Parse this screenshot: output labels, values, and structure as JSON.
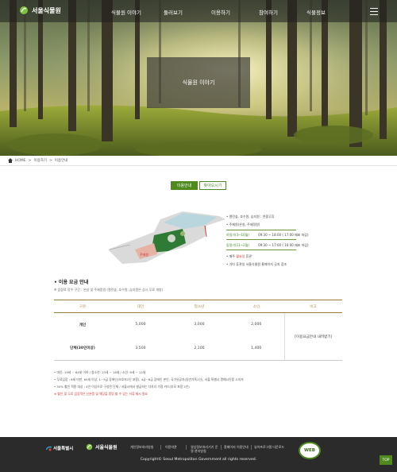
{
  "header": {
    "logo_text": "서울식물원",
    "nav": [
      "식물원 이야기",
      "둘러보기",
      "이용하기",
      "참여하기",
      "식물정보"
    ]
  },
  "hero": {
    "title": "식물원 이야기"
  },
  "breadcrumb": [
    "HOME",
    "이용하기",
    "이용안내"
  ],
  "tabs": [
    "이용안내",
    "찾아오시기"
  ],
  "map_legend": {
    "line1": "• 열린숲, 호수원, 습지원 : 연중무휴",
    "line2": "• 주제원(온실, 주제정원)",
    "hours1_label": "하절기(3~10월)",
    "hours1_value": "09:30 ~ 18:00 ( 17:00 매표 마감)",
    "hours2_label": "동절기(11~2월)",
    "hours2_value": "09:30 ~ 17:00 ( 16:00 매표 마감)",
    "closed_prefix": "• 매주",
    "closed_day": "월요일",
    "closed_suffix": "휴관",
    "holiday": "• 기타 휴관일 서울식물원 홈페이지 공지 참조",
    "zone_label": "주제원"
  },
  "fees": {
    "title": "• 이용 요금 안내",
    "subtitle": "※ 입장료 징수 구간 : 온실 및 주제정원 (열린숲, 호수원, 습지원은 상시 무료 개방)",
    "columns": [
      "구분",
      "대인",
      "청소년",
      "소인",
      "비고"
    ],
    "rows": [
      {
        "label": "개인",
        "adult": "5,000",
        "youth": "3,000",
        "child": "2,000"
      },
      {
        "label": "단체(30인이상)",
        "adult": "3,500",
        "youth": "2,100",
        "child": "1,400"
      }
    ],
    "note": "[이용요금안내 내려받기]"
  },
  "notes": [
    "• 대인: 19세 ~ 64세 이하 / 청소년: 13세 ~ 18세 / 소인: 6세 ~ 12세",
    "• 무료입장 : 6세 미만, 65세 이상, 1~3급 장애인(보호자1인 포함), 4급~6급 장애인 본인, 국가유공자(동반가족1인), 서울 특별시 명예시민증 소지자",
    "• 50% 할인 적용 대상 : 4인 이상으로 구성된 단체 / 서울시에서 발급하는 다자녀 가정 카드(부모 포함 2인)",
    "※ 할인 및 무료 입장객은 신분증 및 해당을 증빙 할 수 있는 서류 제시 필요"
  ],
  "footer": {
    "seoul_logo": "서울특별시",
    "arb_logo": "서울식물원",
    "links": [
      "개인정보처리방침",
      "이용약관",
      "영상정보처리기기 운영·관리방침",
      "홈페이지 이용안내",
      "뷰어프로그램 다운로드"
    ],
    "copyright": "Copyright© Seoul Metropolitan Government all rights reserved.",
    "badge": "WEB",
    "top_label": "TOP"
  },
  "colors": {
    "brand_green": "#4e8a1e",
    "footer_bg": "#2b2b2b",
    "accent_gold": "#9a7c3a"
  }
}
